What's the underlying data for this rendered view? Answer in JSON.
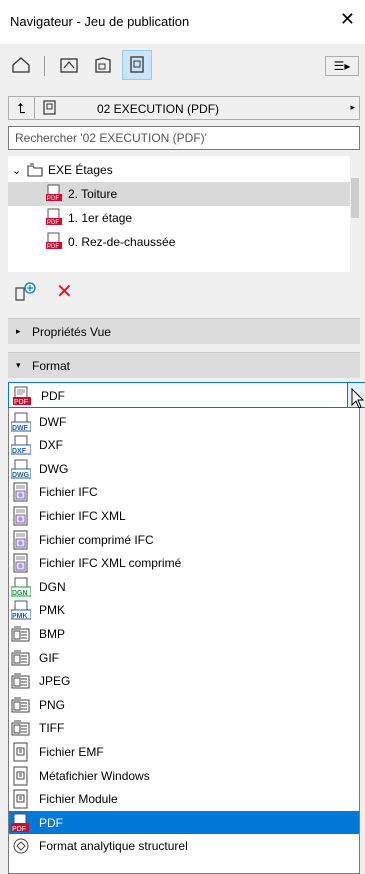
{
  "window": {
    "title": "Navigateur - Jeu de publication",
    "close_glyph": "✕"
  },
  "toolbar": {
    "menu_glyph": "☰▸"
  },
  "publisher_set": {
    "label": "02 EXECUTION (PDF)",
    "up_glyph": "⮤",
    "arrow_glyph": "▸"
  },
  "search": {
    "placeholder": "Rechercher '02 EXECUTION (PDF)'"
  },
  "tree": {
    "folder": {
      "label": "EXE Étages",
      "expander": "⌄"
    },
    "items": [
      {
        "label": "2. Toiture",
        "icon": "pdf-icon"
      },
      {
        "label": "1. 1er étage",
        "icon": "pdf-icon"
      },
      {
        "label": "0. Rez-de-chaussée",
        "icon": "pdf-icon"
      }
    ]
  },
  "actions": {
    "add_icon": "add-page-icon",
    "delete_glyph": "✕"
  },
  "sections": {
    "properties": {
      "label": "Propriétés Vue",
      "tri": "▸"
    },
    "format": {
      "label": "Format",
      "tri": "▾"
    }
  },
  "format_combo": {
    "selected": "PDF",
    "dropdown_glyph": "⌄"
  },
  "format_options": [
    {
      "label": "DWF",
      "icon": "DWF",
      "kind": "doc"
    },
    {
      "label": "DXF",
      "icon": "DXF",
      "kind": "doc"
    },
    {
      "label": "DWG",
      "icon": "DWG",
      "kind": "doc"
    },
    {
      "label": "Fichier IFC",
      "icon": "IFC",
      "kind": "ifc"
    },
    {
      "label": "Fichier IFC XML",
      "icon": "IFC",
      "kind": "ifc"
    },
    {
      "label": "Fichier comprimé IFC",
      "icon": "IFC",
      "kind": "ifc"
    },
    {
      "label": "Fichier IFC XML comprimé",
      "icon": "IFC",
      "kind": "ifc"
    },
    {
      "label": "DGN",
      "icon": "DGN",
      "kind": "doc"
    },
    {
      "label": "PMK",
      "icon": "PMK",
      "kind": "doc"
    },
    {
      "label": "BMP",
      "icon": "IMG",
      "kind": "img"
    },
    {
      "label": "GIF",
      "icon": "IMG",
      "kind": "img"
    },
    {
      "label": "JPEG",
      "icon": "IMG",
      "kind": "img"
    },
    {
      "label": "PNG",
      "icon": "IMG",
      "kind": "img"
    },
    {
      "label": "TIFF",
      "icon": "IMG",
      "kind": "img"
    },
    {
      "label": "Fichier EMF",
      "icon": "EMF",
      "kind": "meta"
    },
    {
      "label": "Métafichier Windows",
      "icon": "WMF",
      "kind": "meta"
    },
    {
      "label": "Fichier Module",
      "icon": "MOD",
      "kind": "meta"
    },
    {
      "label": "PDF",
      "icon": "PDF",
      "kind": "pdf",
      "selected": true
    },
    {
      "label": "Format analytique structurel",
      "icon": "SAF",
      "kind": "saf"
    }
  ],
  "colors": {
    "accent": "#0078d7",
    "pdf_red": "#c8102e",
    "selection_gray": "#d9d9d9"
  }
}
